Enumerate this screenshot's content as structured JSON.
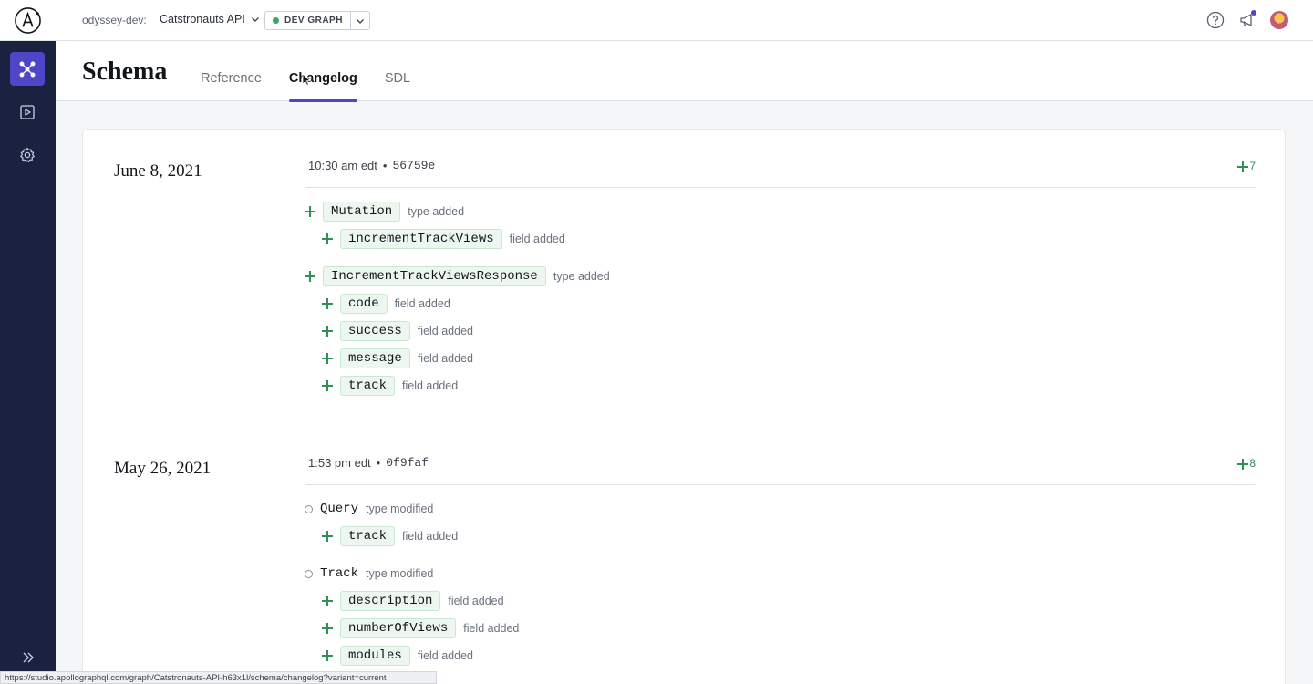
{
  "topbar": {
    "org": "odyssey-dev:",
    "graph_name": "Catstronauts API",
    "variant": "DEV GRAPH"
  },
  "header": {
    "title": "Schema",
    "tabs": [
      {
        "label": "Reference",
        "active": false
      },
      {
        "label": "Changelog",
        "active": true
      },
      {
        "label": "SDL",
        "active": false
      }
    ]
  },
  "entries": [
    {
      "date": "June 8, 2021",
      "time": "10:30 am edt",
      "hash": "56759e",
      "count": "7",
      "changes": [
        {
          "kind": "add",
          "level": 0,
          "name": "Mutation",
          "desc": "type added"
        },
        {
          "kind": "add",
          "level": 1,
          "name": "incrementTrackViews",
          "desc": "field added"
        },
        {
          "kind": "add",
          "level": 0,
          "name": "IncrementTrackViewsResponse",
          "desc": "type added"
        },
        {
          "kind": "add",
          "level": 1,
          "name": "code",
          "desc": "field added"
        },
        {
          "kind": "add",
          "level": 1,
          "name": "success",
          "desc": "field added"
        },
        {
          "kind": "add",
          "level": 1,
          "name": "message",
          "desc": "field added"
        },
        {
          "kind": "add",
          "level": 1,
          "name": "track",
          "desc": "field added"
        }
      ]
    },
    {
      "date": "May 26, 2021",
      "time": "1:53 pm edt",
      "hash": "0f9faf",
      "count": "8",
      "changes": [
        {
          "kind": "modify",
          "level": 0,
          "name": "Query",
          "desc": "type modified"
        },
        {
          "kind": "add",
          "level": 1,
          "name": "track",
          "desc": "field added"
        },
        {
          "kind": "modify",
          "level": 0,
          "name": "Track",
          "desc": "type modified"
        },
        {
          "kind": "add",
          "level": 1,
          "name": "description",
          "desc": "field added"
        },
        {
          "kind": "add",
          "level": 1,
          "name": "numberOfViews",
          "desc": "field added"
        },
        {
          "kind": "add",
          "level": 1,
          "name": "modules",
          "desc": "field added"
        }
      ]
    }
  ],
  "statusbar": {
    "url": "https://studio.apollographql.com/graph/Catstronauts-API-h63x1l/schema/changelog?variant=current"
  },
  "colors": {
    "accent": "#4f45c9",
    "rail": "#1b2240",
    "added": "#2f8f56"
  }
}
